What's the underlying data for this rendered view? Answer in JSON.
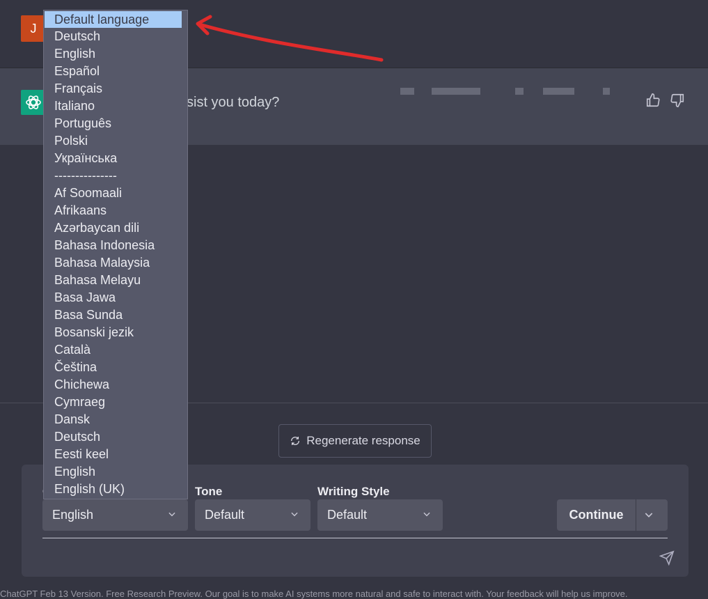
{
  "user": {
    "avatar_letter": "J"
  },
  "assistant": {
    "message_fragment": "sist you today?"
  },
  "regenerate": {
    "label": "Regenerate response"
  },
  "controls": {
    "output_label": "O",
    "tone_label": "Tone",
    "style_label": "Writing Style",
    "language_value": "English",
    "tone_value": "Default",
    "style_value": "Default",
    "continue_label": "Continue"
  },
  "dropdown": {
    "items": [
      "Default language",
      "Deutsch",
      "English",
      "Español",
      "Français",
      "Italiano",
      "Português",
      "Polski",
      "Українська",
      "---------------",
      "Af Soomaali",
      "Afrikaans",
      "Azərbaycan dili",
      "Bahasa Indonesia",
      "Bahasa Malaysia",
      "Bahasa Melayu",
      "Basa Jawa",
      "Basa Sunda",
      "Bosanski jezik",
      "Català",
      "Čeština",
      "Chichewa",
      "Cymraeg",
      "Dansk",
      "Deutsch",
      "Eesti keel",
      "English",
      "English (UK)"
    ]
  },
  "footer": {
    "text": "ChatGPT Feb 13 Version. Free Research Preview. Our goal is to make AI systems more natural and safe to interact with. Your feedback will help us improve."
  },
  "colors": {
    "accent_highlight": "#a7ccf6",
    "annotation_arrow": "#e02b2b",
    "gpt_green": "#10a37f",
    "user_avatar": "#c8481c"
  },
  "icons": [
    "openai-logo-icon",
    "thumbs-up-icon",
    "thumbs-down-icon",
    "refresh-icon",
    "chevron-down-icon",
    "send-icon"
  ]
}
